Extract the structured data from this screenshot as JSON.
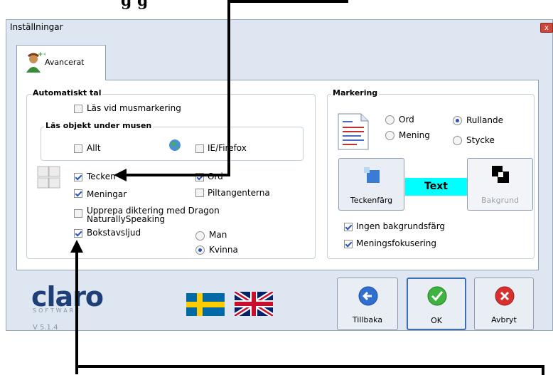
{
  "caption": "g                    g",
  "window": {
    "title": "Inställningar",
    "close": "x"
  },
  "tabs": [
    {
      "label": "Avancerat"
    }
  ],
  "auto_speech": {
    "title": "Automatiskt tal",
    "read_on_mouse": "Läs vid musmarkering",
    "under_mouse_title": "Läs objekt under musen",
    "all": "Allt",
    "iefirefox": "IE/Firefox",
    "words_checked": "Tecken",
    "words": "Ord",
    "sentences": "Meningar",
    "arrow_keys": "Piltangenterna",
    "repeat_dragon": "Upprepa diktering med Dragon NaturallySpeaking",
    "letter_sounds": "Bokstavsljud",
    "voice_male": "Man",
    "voice_female": "Kvinna"
  },
  "marking": {
    "title": "Markering",
    "word": "Ord",
    "sentence": "Mening",
    "rolling": "Rullande",
    "paragraph": "Stycke",
    "text_color": "Teckenfärg",
    "sample_text": "Text",
    "background": "Bakgrund",
    "no_bg_color": "Ingen bakgrundsfärg",
    "sentence_focus": "Meningsfokusering"
  },
  "footer": {
    "logo_text": "claro",
    "logo_sub": "SOFTWARE",
    "version": "V 5.1.4",
    "back": "Tillbaka",
    "ok": "OK",
    "cancel": "Avbryt"
  },
  "colors": {
    "accent": "#2a52be",
    "window_bg": "#dde6f1",
    "text_sample_bg": "#00ffff",
    "logo": "#1e3f78"
  }
}
